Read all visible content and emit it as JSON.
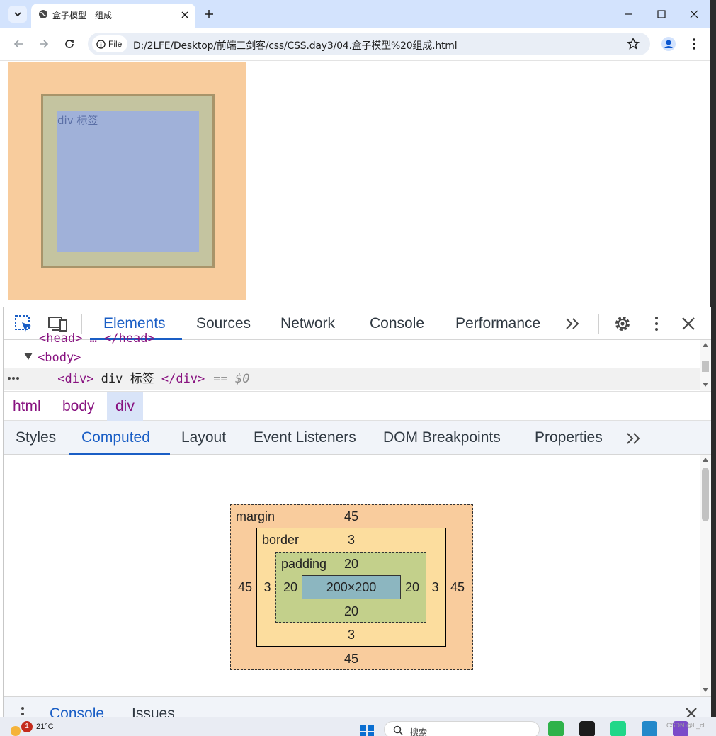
{
  "browser": {
    "tab_title": "盒子模型—组成",
    "security_chip": "File",
    "url": "D:/2LFE/Desktop/前端三剑客/css/CSS.day3/04.盒子模型%20组成.html"
  },
  "page": {
    "div_text": "div 标签",
    "colors": {
      "margin": "#f8cc9d",
      "border": "#a8946a",
      "padding": "#c4c4a0",
      "content": "#a0b1d9"
    }
  },
  "devtools": {
    "tabs": [
      "Elements",
      "Sources",
      "Network",
      "Console",
      "Performance"
    ],
    "active_tab": "Elements",
    "more_tabs_icon": "chevron-double-right-icon",
    "dom": {
      "partial_line": "<head> … </head>",
      "body_open": "<body>",
      "div_open": "<div>",
      "div_text": " div 标签 ",
      "div_close": "</div>",
      "selected_suffix": "== $0"
    },
    "breadcrumbs": [
      "html",
      "body",
      "div"
    ],
    "active_crumb": "div",
    "subtabs": [
      "Styles",
      "Computed",
      "Layout",
      "Event Listeners",
      "DOM Breakpoints",
      "Properties"
    ],
    "active_subtab": "Computed",
    "box_model": {
      "margin_label": "margin",
      "border_label": "border",
      "padding_label": "padding",
      "margin": {
        "top": "45",
        "right": "45",
        "bottom": "45",
        "left": "45"
      },
      "border": {
        "top": "3",
        "right": "3",
        "bottom": "3",
        "left": "3"
      },
      "padding": {
        "top": "20",
        "right": "20",
        "bottom": "20",
        "left": "20"
      },
      "content": "200×200",
      "colors": {
        "margin": "#f9cc9d",
        "border": "#fcdd9e",
        "padding": "#c3d08b",
        "content": "#8cb6c0"
      }
    },
    "drawer_tabs": [
      "Console",
      "Issues"
    ]
  },
  "taskbar": {
    "notification_count": "1",
    "temperature": "21°C",
    "search_placeholder": "搜索",
    "watermark": "CSDN @L_cl"
  }
}
